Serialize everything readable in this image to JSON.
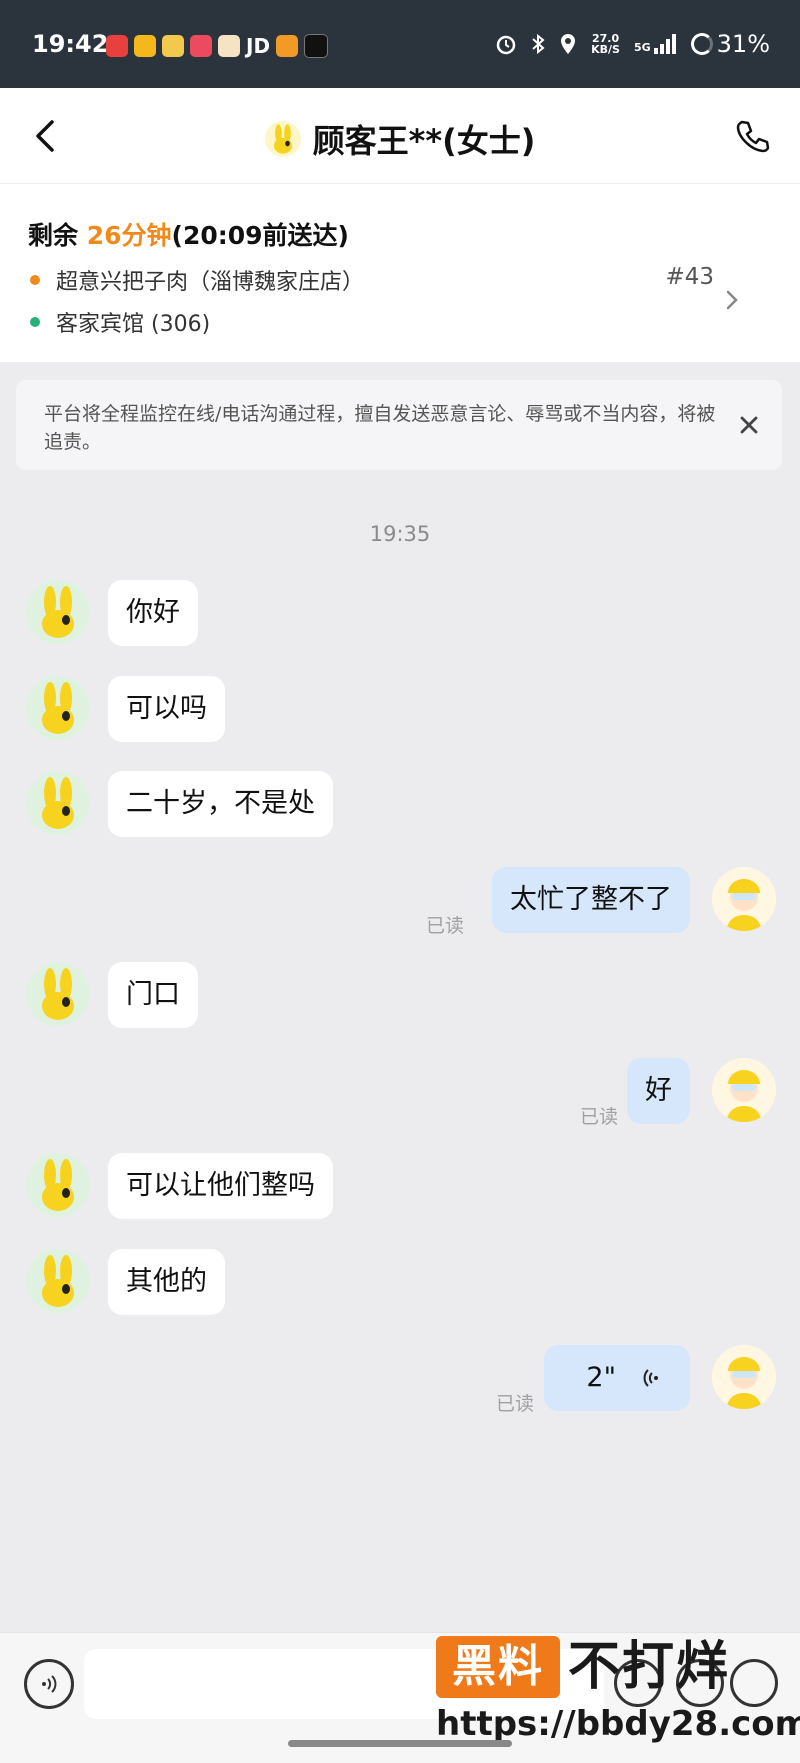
{
  "status_bar": {
    "time": "19:42",
    "jd_label": "JD",
    "net_speed_value": "27.0",
    "net_speed_unit": "KB/S",
    "signal_label": "5G",
    "battery": "31%"
  },
  "header": {
    "title": "顾客王**(女士)"
  },
  "order": {
    "remaining_prefix": "剩余",
    "remaining_minutes": "26分钟",
    "deadline": "(20:09前送达)",
    "store": "超意兴把子肉（淄博魏家庄店）",
    "order_number": "#43",
    "destination": "客家宾馆 (306)"
  },
  "notice": {
    "text": "平台将全程监控在线/电话沟通过程，擅自发送恶意言论、辱骂或不当内容，将被追责。"
  },
  "chat": {
    "timestamp": "19:35",
    "read_label": "已读",
    "messages": [
      {
        "side": "left",
        "text": "你好"
      },
      {
        "side": "left",
        "text": "可以吗"
      },
      {
        "side": "left",
        "text": "二十岁，不是处"
      },
      {
        "side": "right",
        "text": "太忙了整不了"
      },
      {
        "side": "left",
        "text": "门口"
      },
      {
        "side": "right",
        "text": "好"
      },
      {
        "side": "left",
        "text": "可以让他们整吗"
      },
      {
        "side": "left",
        "text": "其他的"
      },
      {
        "side": "right",
        "text": "2\"",
        "type": "voice"
      }
    ]
  },
  "watermark": {
    "badge": "黑料",
    "text": "不打烊",
    "url": "https://bbdy28.com"
  },
  "colors": {
    "accent_orange": "#f08a1c",
    "status_green": "#26b07a",
    "bubble_blue": "#d6e7fb",
    "status_bar_bg": "#2b333d"
  }
}
